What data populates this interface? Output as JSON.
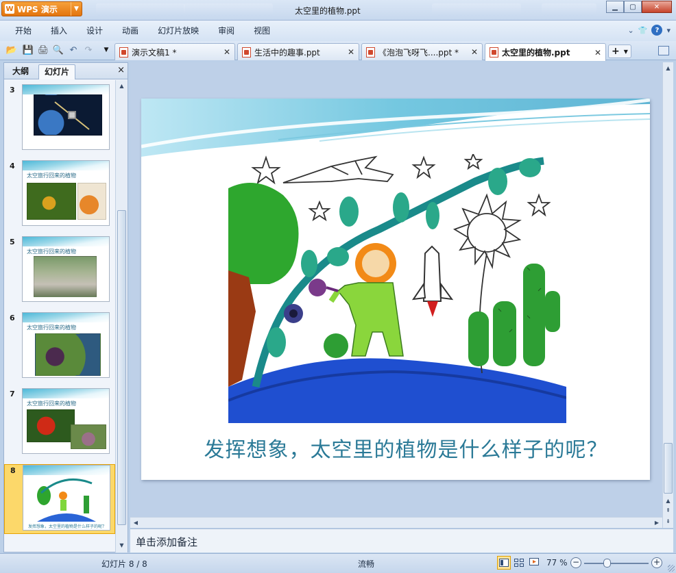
{
  "app": {
    "button_label": "WPS 演示",
    "window_title": "太空里的植物.ppt"
  },
  "menu": {
    "items": [
      "开始",
      "插入",
      "设计",
      "动画",
      "幻灯片放映",
      "审阅",
      "视图"
    ]
  },
  "doc_tabs": [
    {
      "label": "演示文稿1 *",
      "active": false
    },
    {
      "label": "生活中的趣事.ppt",
      "active": false
    },
    {
      "label": "《泡泡飞呀飞....ppt *",
      "active": false
    },
    {
      "label": "太空里的植物.ppt",
      "active": true
    }
  ],
  "left_pane": {
    "tab_outline": "大纲",
    "tab_slides": "幻灯片",
    "close_glyph": "×",
    "slides": [
      {
        "number": "3",
        "title": ""
      },
      {
        "number": "4",
        "title": "太空旅行回来的植物"
      },
      {
        "number": "5",
        "title": "太空旅行回来的植物"
      },
      {
        "number": "6",
        "title": "太空旅行回来的植物"
      },
      {
        "number": "7",
        "title": "太空旅行回来的植物"
      },
      {
        "number": "8",
        "title": "",
        "caption": "发挥想象，太空里的植物是什么样子的呢？",
        "selected": true
      }
    ]
  },
  "slide": {
    "caption": "发挥想象，太空里的植物是什么样子的呢？",
    "accent_color": "#2b7a97"
  },
  "notes": {
    "placeholder": "单击添加备注"
  },
  "status": {
    "slide_count": "幻灯片 8 / 8",
    "theme_name": "流畅",
    "zoom": "77 %"
  }
}
